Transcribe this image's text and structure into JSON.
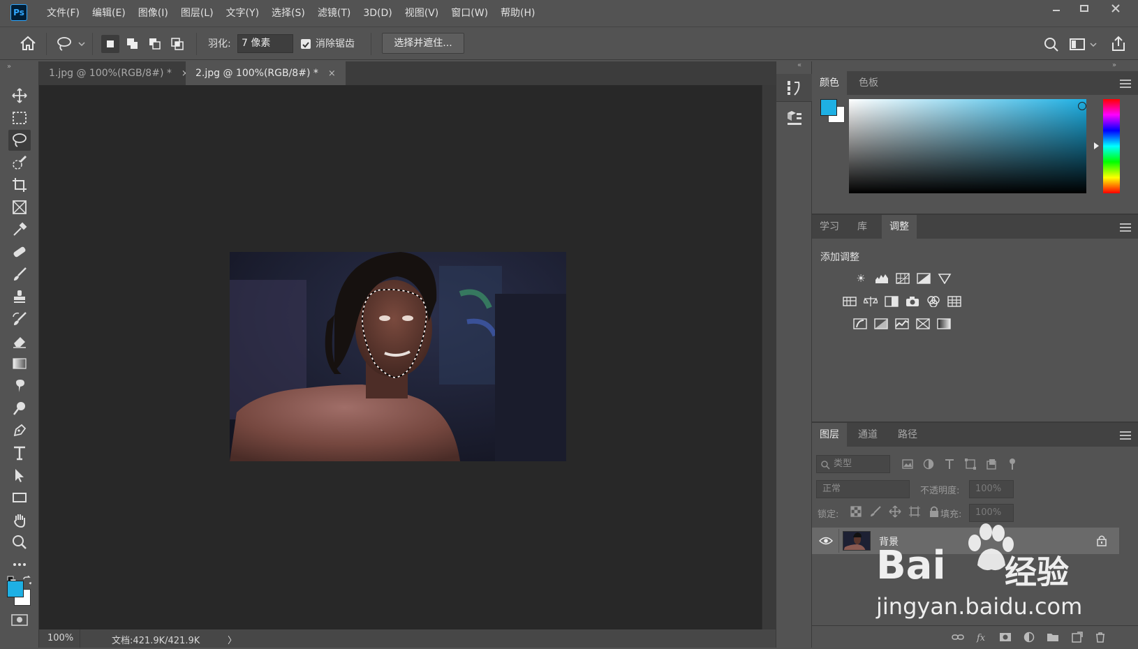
{
  "app": {
    "logo": "Ps"
  },
  "menu": [
    "文件(F)",
    "编辑(E)",
    "图像(I)",
    "图层(L)",
    "文字(Y)",
    "选择(S)",
    "滤镜(T)",
    "3D(D)",
    "视图(V)",
    "窗口(W)",
    "帮助(H)"
  ],
  "options": {
    "feather_label": "羽化:",
    "feather_value": "7 像素",
    "antialias_label": "消除锯齿",
    "antialias_checked": true,
    "select_mask_button": "选择并遮住..."
  },
  "tabs": [
    {
      "label": "1.jpg @ 100%(RGB/8#) *",
      "active": false
    },
    {
      "label": "2.jpg @ 100%(RGB/8#) *",
      "active": true
    }
  ],
  "tab_close_glyph": "×",
  "statusbar": {
    "zoom": "100%",
    "doc_info": "文档:421.9K/421.9K",
    "arrow": "〉"
  },
  "color_panel": {
    "tabs": [
      "颜色",
      "色板"
    ],
    "foreground": "#1eb0e4",
    "background": "#ffffff"
  },
  "adjust_panel": {
    "tabs": [
      "学习",
      "库",
      "调整"
    ],
    "heading": "添加调整"
  },
  "layers_panel": {
    "tabs": [
      "图层",
      "通道",
      "路径"
    ],
    "filter_placeholder": "类型",
    "blend_mode": "正常",
    "opacity_label": "不透明度:",
    "opacity_value": "100%",
    "lock_label": "锁定:",
    "fill_label": "填充:",
    "fill_value": "100%",
    "layers": [
      {
        "name": "背景",
        "visible": true,
        "locked": true
      }
    ]
  },
  "watermark": {
    "brand": "Bai",
    "brand2": "经验",
    "url": "jingyan.baidu.com"
  }
}
